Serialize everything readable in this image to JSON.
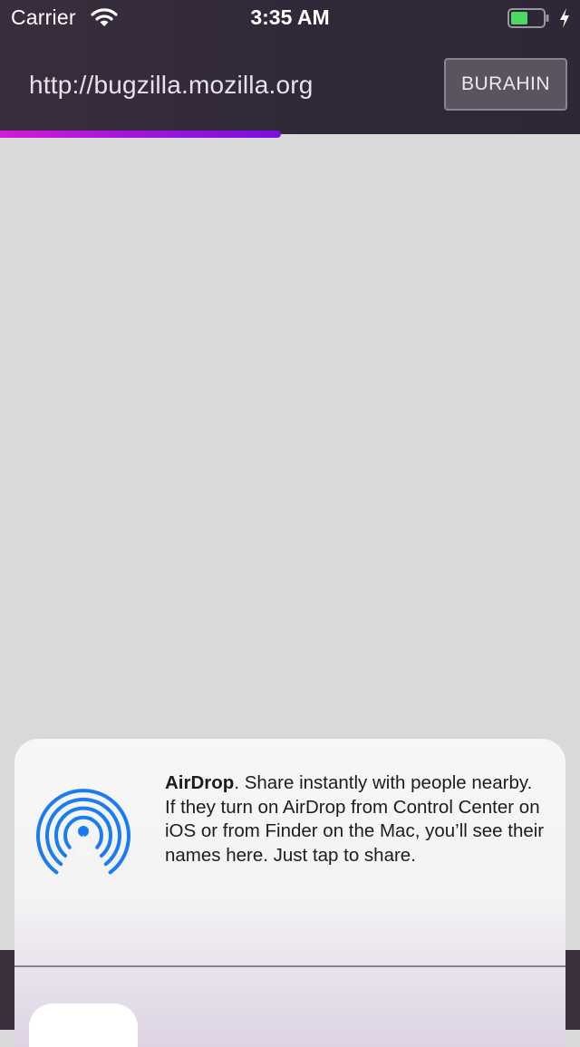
{
  "status_bar": {
    "carrier": "Carrier",
    "time": "3:35 AM",
    "wifi_icon": "wifi-icon",
    "battery_icon": "battery-icon",
    "charging_icon": "bolt-icon",
    "battery_color": "#4cd964"
  },
  "toolbar": {
    "url": "http://bugzilla.mozilla.org",
    "cancel_label": "BURAHIN",
    "progress": 0.485,
    "progress_colors": [
      "#d21cd6",
      "#7a10de"
    ]
  },
  "share_sheet": {
    "airdrop_icon": "airdrop-icon",
    "airdrop_color": "#1a7cf0",
    "airdrop_title": "AirDrop",
    "airdrop_body": ". Share instantly with people nearby. If they turn on AirDrop from Control Center on iOS or from Finder on the Mac, you’ll see their names here. Just tap to share."
  }
}
